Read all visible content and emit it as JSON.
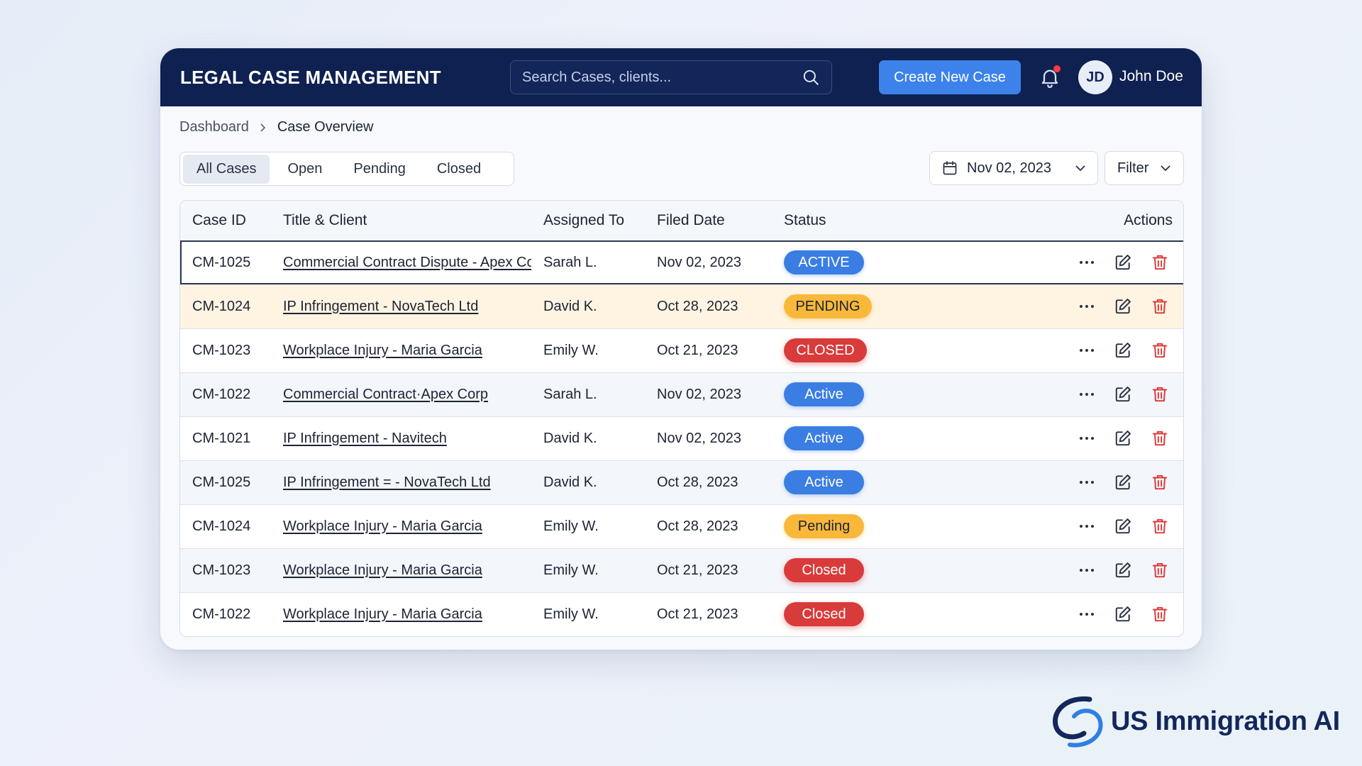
{
  "header": {
    "title": "LEGAL CASE MANAGEMENT",
    "search_placeholder": "Search Cases, clients...",
    "create_label": "Create New Case",
    "user_initials": "JD",
    "user_name": "John Doe"
  },
  "breadcrumb": {
    "parent": "Dashboard",
    "current": "Case Overview"
  },
  "tabs": [
    "All Cases",
    "Open",
    "Pending",
    "Closed"
  ],
  "toolbar": {
    "date": "Nov 02, 2023",
    "filter_label": "Filter"
  },
  "table": {
    "columns": [
      "Case ID",
      "Title & Client",
      "Assigned To",
      "Filed Date",
      "Status",
      "Actions"
    ],
    "rows": [
      {
        "id": "CM-1025",
        "title": "Commercial Contract Dispute - Apex Corp",
        "assigned": "Sarah L.",
        "date": "Nov 02, 2023",
        "status": "ACTIVE"
      },
      {
        "id": "CM-1024",
        "title": "IP Infringement - NovaTech Ltd",
        "assigned": "David K.",
        "date": "Oct 28, 2023",
        "status": "PENDING"
      },
      {
        "id": "CM-1023",
        "title": "Workplace Injury - Maria Garcia",
        "assigned": "Emily W.",
        "date": "Oct 21, 2023",
        "status": "CLOSED"
      },
      {
        "id": "CM-1022",
        "title": "Commercial Contract·Apex Corp",
        "assigned": "Sarah L.",
        "date": "Nov 02, 2023",
        "status": "Active"
      },
      {
        "id": "CM-1021",
        "title": "IP Infringement - Navitech",
        "assigned": "David K.",
        "date": "Nov 02, 2023",
        "status": "Active"
      },
      {
        "id": "CM-1025",
        "title": "IP Infringement = - NovaTech Ltd",
        "assigned": "David K.",
        "date": "Oct 28, 2023",
        "status": "Active"
      },
      {
        "id": "CM-1024",
        "title": "Workplace Injury - Maria Garcia",
        "assigned": "Emily W.",
        "date": "Oct 28, 2023",
        "status": "Pending"
      },
      {
        "id": "CM-1023",
        "title": "Workplace Injury - Maria Garcia",
        "assigned": "Emily W.",
        "date": "Oct 21, 2023",
        "status": "Closed"
      },
      {
        "id": "CM-1022",
        "title": "Workplace Injury - Maria Garcia",
        "assigned": "Emily W.",
        "date": "Oct 21, 2023",
        "status": "Closed"
      }
    ]
  },
  "brand": {
    "name": "US Immigration AI"
  },
  "colors": {
    "header_bg": "#0f2150",
    "primary": "#3c82ea",
    "active": "#3a7de3",
    "pending": "#f9b83a",
    "closed": "#d93a3a",
    "highlight_row": "#fff4e2"
  }
}
